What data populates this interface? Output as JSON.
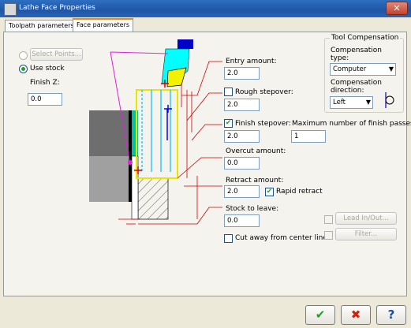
{
  "window": {
    "title": "Lathe Face Properties",
    "close_glyph": "✕"
  },
  "tabs": [
    {
      "label": "Toolpath parameters",
      "active": false
    },
    {
      "label": "Face parameters",
      "active": true
    }
  ],
  "left": {
    "select_points_label": "Select Points...",
    "use_stock_label": "Use stock",
    "use_stock_selected": true,
    "finish_z_label": "Finish Z:",
    "finish_z_value": "0.0"
  },
  "params": {
    "entry_amount_label": "Entry amount:",
    "entry_amount_value": "2.0",
    "rough_stepover_label": "Rough stepover:",
    "rough_stepover_value": "2.0",
    "rough_stepover_checked": false,
    "finish_stepover_label": "Finish stepover:",
    "finish_stepover_value": "2.0",
    "finish_stepover_checked": true,
    "max_finish_passes_label": "Maximum number of finish passes:",
    "max_finish_passes_value": "1",
    "overcut_amount_label": "Overcut amount:",
    "overcut_amount_value": "0.0",
    "retract_amount_label": "Retract amount:",
    "retract_amount_value": "2.0",
    "rapid_retract_label": "Rapid retract",
    "rapid_retract_checked": true,
    "stock_to_leave_label": "Stock to leave:",
    "stock_to_leave_value": "0.0",
    "cut_away_label": "Cut away from center line",
    "cut_away_checked": false
  },
  "tool_compensation": {
    "title": "Tool Compensation",
    "type_label": "Compensation type:",
    "type_value": "Computer",
    "direction_label": "Compensation direction:",
    "direction_value": "Left"
  },
  "side_buttons": {
    "lead_in_out_label": "Lead In/Out...",
    "filter_label": "Filter..."
  },
  "bottom_buttons": {
    "ok_glyph": "✔",
    "cancel_glyph": "✖",
    "help_glyph": "?"
  },
  "colors": {
    "ok": "#21a121",
    "cancel": "#d02010",
    "help": "#1a4fa0",
    "diagram_lines": "#d00000",
    "tool_path": "#00c0ff",
    "stock_outline": "#e6e600",
    "arc": "#e020e0"
  }
}
